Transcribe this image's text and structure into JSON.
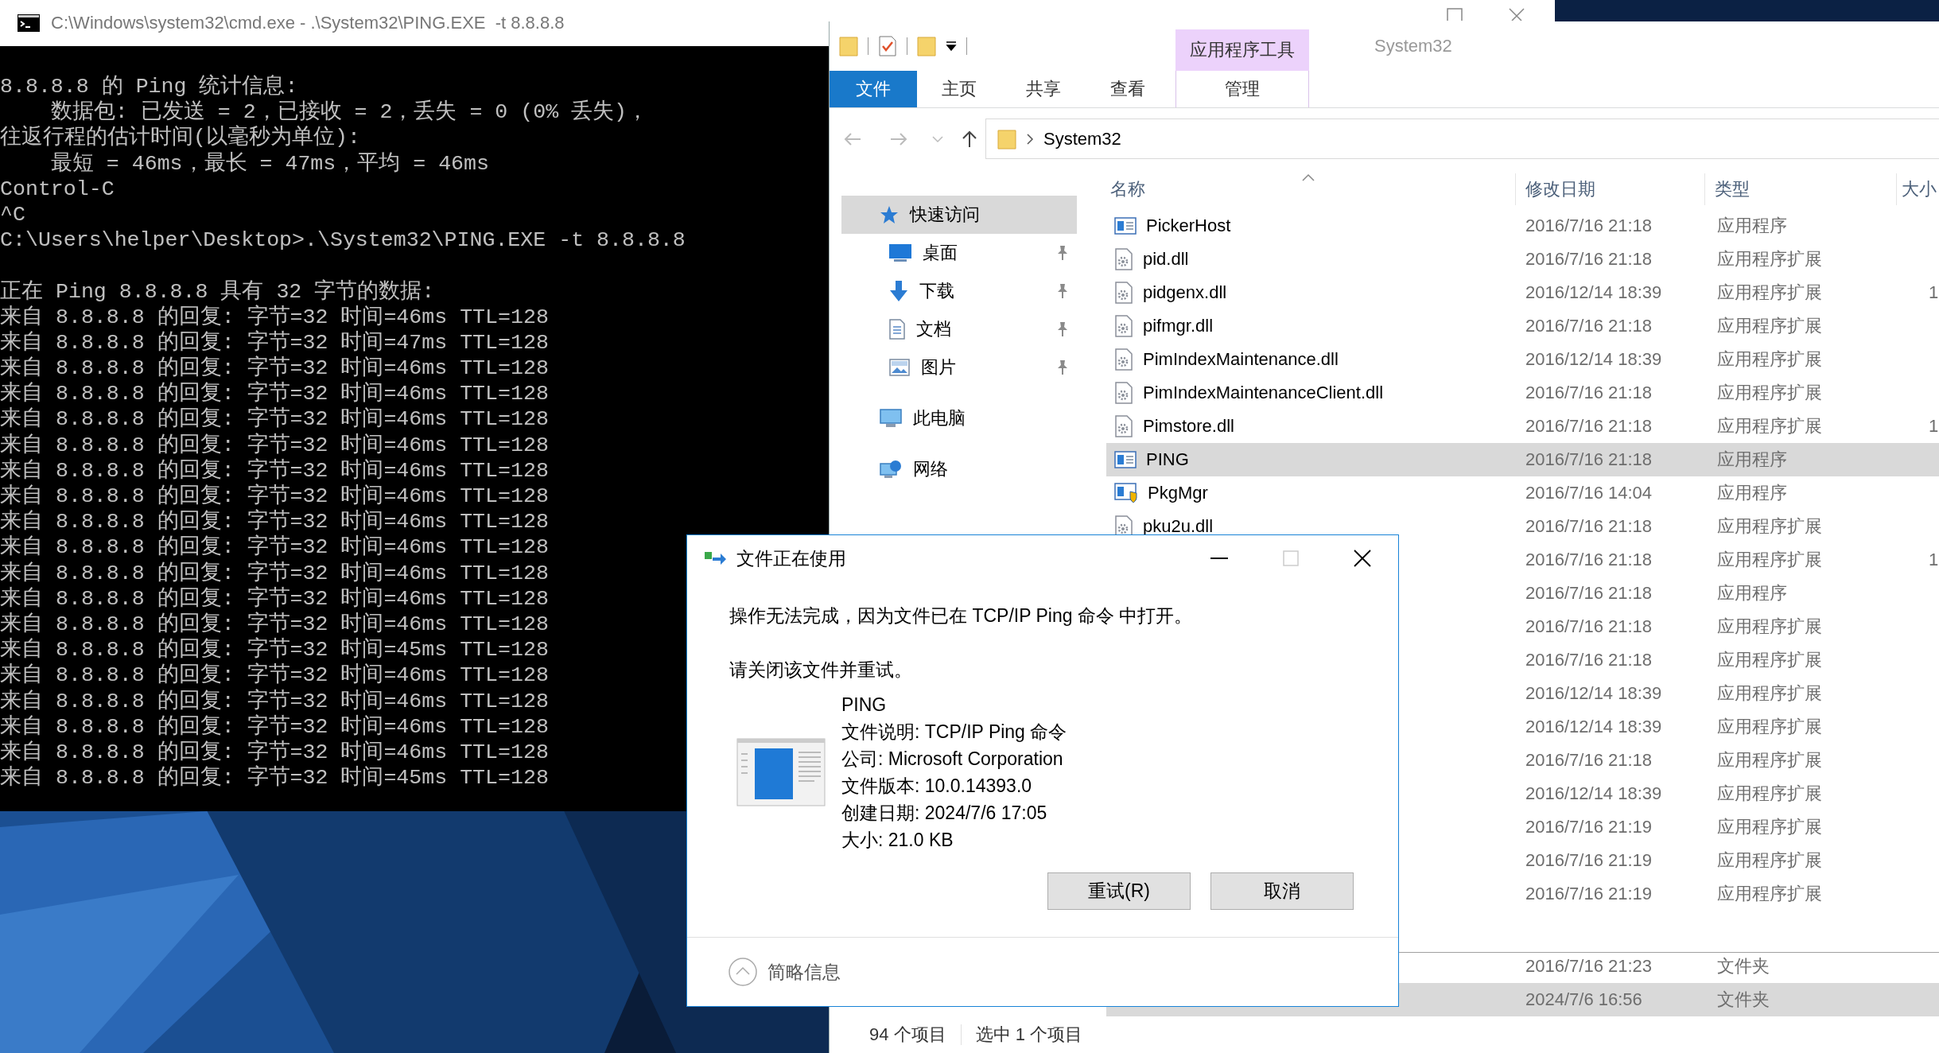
{
  "console": {
    "title": "C:\\Windows\\system32\\cmd.exe - .\\System32\\PING.EXE  -t 8.8.8.8",
    "blocks": [
      [
        "8.8.8.8 的 Ping 统计信息:",
        "    数据包: 已发送 = 2，已接收 = 2，丢失 = 0 (0% 丢失)，",
        "往返行程的估计时间(以毫秒为单位):",
        "    最短 = 46ms，最长 = 47ms，平均 = 46ms",
        "Control-C",
        "^C",
        "C:\\Users\\helper\\Desktop>.\\System32\\PING.EXE -t 8.8.8.8"
      ],
      [
        "正在 Ping 8.8.8.8 具有 32 字节的数据:",
        "来自 8.8.8.8 的回复: 字节=32 时间=46ms TTL=128",
        "来自 8.8.8.8 的回复: 字节=32 时间=47ms TTL=128",
        "来自 8.8.8.8 的回复: 字节=32 时间=46ms TTL=128",
        "来自 8.8.8.8 的回复: 字节=32 时间=46ms TTL=128",
        "来自 8.8.8.8 的回复: 字节=32 时间=46ms TTL=128",
        "来自 8.8.8.8 的回复: 字节=32 时间=46ms TTL=128",
        "来自 8.8.8.8 的回复: 字节=32 时间=46ms TTL=128",
        "来自 8.8.8.8 的回复: 字节=32 时间=46ms TTL=128",
        "来自 8.8.8.8 的回复: 字节=32 时间=46ms TTL=128",
        "来自 8.8.8.8 的回复: 字节=32 时间=46ms TTL=128",
        "来自 8.8.8.8 的回复: 字节=32 时间=46ms TTL=128",
        "来自 8.8.8.8 的回复: 字节=32 时间=46ms TTL=128",
        "来自 8.8.8.8 的回复: 字节=32 时间=46ms TTL=128",
        "来自 8.8.8.8 的回复: 字节=32 时间=45ms TTL=128",
        "来自 8.8.8.8 的回复: 字节=32 时间=46ms TTL=128",
        "来自 8.8.8.8 的回复: 字节=32 时间=46ms TTL=128",
        "来自 8.8.8.8 的回复: 字节=32 时间=46ms TTL=128",
        "来自 8.8.8.8 的回复: 字节=32 时间=46ms TTL=128",
        "来自 8.8.8.8 的回复: 字节=32 时间=45ms TTL=128"
      ]
    ]
  },
  "explorer": {
    "contextual_group": "应用程序工具",
    "title": "System32",
    "ribbon_tabs": [
      {
        "label": "文件",
        "kind": "file"
      },
      {
        "label": "主页",
        "kind": "tab"
      },
      {
        "label": "共享",
        "kind": "tab"
      },
      {
        "label": "查看",
        "kind": "tab"
      },
      {
        "label": "管理",
        "kind": "contextual"
      }
    ],
    "breadcrumb": [
      "System32"
    ],
    "nav": [
      {
        "label": "快速访问",
        "kind": "star",
        "selected": true,
        "children": [
          {
            "label": "桌面",
            "kind": "desktop",
            "selected": false,
            "pinned": true
          },
          {
            "label": "下载",
            "kind": "download",
            "selected": false,
            "pinned": true
          },
          {
            "label": "文档",
            "kind": "document",
            "selected": false,
            "pinned": true
          },
          {
            "label": "图片",
            "kind": "pictures",
            "selected": false,
            "pinned": true
          }
        ]
      },
      {
        "label": "此电脑",
        "kind": "computer",
        "selected": false
      },
      {
        "label": "网络",
        "kind": "network",
        "selected": false
      }
    ],
    "columns": [
      "名称",
      "修改日期",
      "类型",
      "大小"
    ],
    "rows": [
      {
        "name": "PickerHost",
        "kind": "app",
        "date": "2016/7/16 21:18",
        "type": "应用程序",
        "selected": false
      },
      {
        "name": "pid.dll",
        "kind": "dll",
        "date": "2016/7/16 21:18",
        "type": "应用程序扩展",
        "selected": false
      },
      {
        "name": "pidgenx.dll",
        "kind": "dll",
        "date": "2016/12/14 18:39",
        "type": "应用程序扩展",
        "size": "1",
        "selected": false
      },
      {
        "name": "pifmgr.dll",
        "kind": "dll",
        "date": "2016/7/16 21:18",
        "type": "应用程序扩展",
        "selected": false
      },
      {
        "name": "PimIndexMaintenance.dll",
        "kind": "dll",
        "date": "2016/12/14 18:39",
        "type": "应用程序扩展",
        "selected": false
      },
      {
        "name": "PimIndexMaintenanceClient.dll",
        "kind": "dll",
        "date": "2016/7/16 21:18",
        "type": "应用程序扩展",
        "selected": false
      },
      {
        "name": "Pimstore.dll",
        "kind": "dll",
        "date": "2016/7/16 21:18",
        "type": "应用程序扩展",
        "size": "1",
        "selected": false
      },
      {
        "name": "PING",
        "kind": "app",
        "date": "2016/7/16 21:18",
        "type": "应用程序",
        "selected": true
      },
      {
        "name": "PkgMgr",
        "kind": "installer",
        "date": "2016/7/16 14:04",
        "type": "应用程序",
        "selected": false
      },
      {
        "name": "pku2u.dll",
        "kind": "dll",
        "date": "2016/7/16 21:18",
        "type": "应用程序扩展",
        "selected": false
      },
      {
        "date": "2016/7/16 21:18",
        "type": "应用程序扩展",
        "size": "1",
        "selected": false
      },
      {
        "date": "2016/7/16 21:18",
        "type": "应用程序",
        "selected": false
      },
      {
        "date": "2016/7/16 21:18",
        "type": "应用程序扩展",
        "selected": false
      },
      {
        "date": "2016/7/16 21:18",
        "type": "应用程序扩展",
        "selected": false
      },
      {
        "date": "2016/12/14 18:39",
        "type": "应用程序扩展",
        "selected": false
      },
      {
        "date": "2016/12/14 18:39",
        "type": "应用程序扩展",
        "selected": false
      },
      {
        "date": "2016/7/16 21:18",
        "type": "应用程序扩展",
        "selected": false
      },
      {
        "date": "2016/12/14 18:39",
        "type": "应用程序扩展",
        "selected": false
      },
      {
        "date": "2016/7/16 21:19",
        "type": "应用程序扩展",
        "selected": false
      },
      {
        "date": "2016/7/16 21:19",
        "type": "应用程序扩展",
        "selected": false
      },
      {
        "date": "2016/7/16 21:19",
        "type": "应用程序扩展",
        "selected": false
      }
    ],
    "lower_rows": [
      {
        "date": "2016/7/16 21:23",
        "type": "文件夹",
        "selected": false
      },
      {
        "date": "2024/7/6 16:56",
        "type": "文件夹",
        "selected": true
      }
    ],
    "status": [
      "94 个项目",
      "选中 1 个项目"
    ]
  },
  "dialog": {
    "title": "文件正在使用",
    "message": "操作无法完成，因为文件已在 TCP/IP Ping 命令 中打开。",
    "instruction": "请关闭该文件并重试。",
    "file_name": "PING",
    "details": [
      "文件说明: TCP/IP Ping 命令",
      "公司: Microsoft Corporation",
      "文件版本: 10.0.14393.0",
      "创建日期: 2024/7/6 17:05",
      "大小: 21.0 KB"
    ],
    "buttons": [
      "重试(R)",
      "取消"
    ],
    "footer": "简略信息"
  }
}
